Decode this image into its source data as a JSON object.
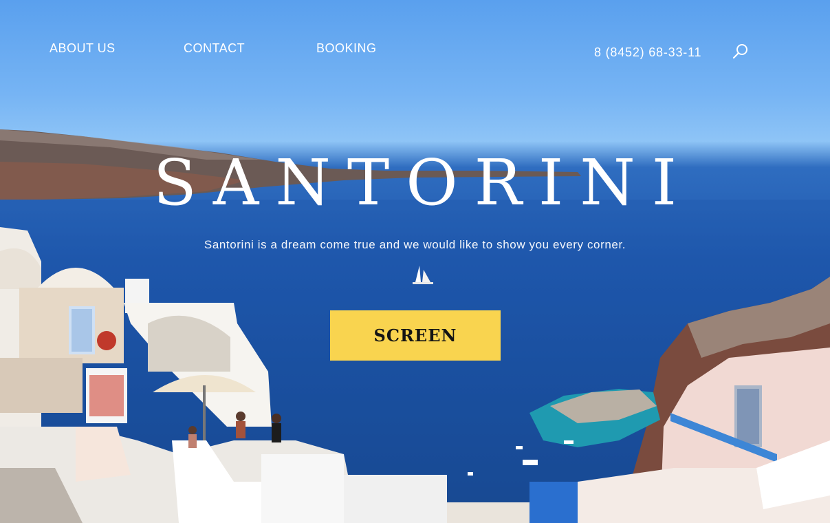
{
  "nav": {
    "items": [
      {
        "label": "ABOUT US"
      },
      {
        "label": "CONTACT"
      },
      {
        "label": "BOOKING"
      }
    ],
    "phone": "8 (8452) 68-33-11",
    "search_icon": "search-icon"
  },
  "hero": {
    "title": "SANTORINI",
    "subtitle": "Santorini is a dream come true and we would like to show you every corner.",
    "cta_label": "SCREEN"
  },
  "colors": {
    "accent": "#f9d44f",
    "sky": "#5aa0ee",
    "sea": "#1f58ad",
    "text": "#ffffff"
  }
}
